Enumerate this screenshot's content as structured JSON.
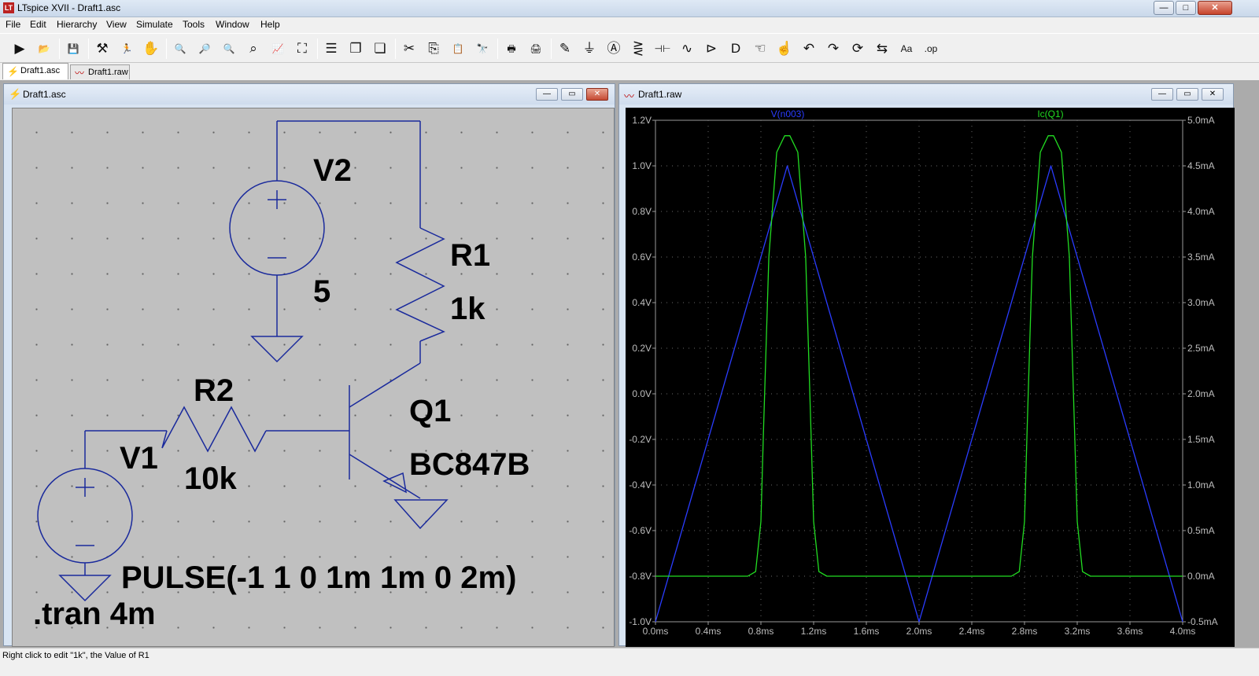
{
  "app": {
    "title": "LTspice XVII - Draft1.asc",
    "icon": "ltspice-icon",
    "window_controls": {
      "minimize": "—",
      "maximize": "□",
      "close": "✕"
    }
  },
  "menu": [
    "File",
    "Edit",
    "Hierarchy",
    "View",
    "Simulate",
    "Tools",
    "Window",
    "Help"
  ],
  "toolbar": [
    {
      "name": "open-schematic-icon",
      "glyph": "▶"
    },
    {
      "name": "open-folder-icon",
      "glyph": "📂"
    },
    {
      "name": "save-icon",
      "glyph": "💾"
    },
    {
      "name": "control-panel-icon",
      "glyph": "⚒"
    },
    {
      "name": "run-icon",
      "glyph": "🏃"
    },
    {
      "name": "halt-hand-icon",
      "glyph": "✋"
    },
    {
      "name": "zoom-in-icon",
      "glyph": "🔍"
    },
    {
      "name": "pan-icon",
      "glyph": "🔎"
    },
    {
      "name": "zoom-out-icon",
      "glyph": "🔍"
    },
    {
      "name": "zoom-cancel-icon",
      "glyph": "⌕"
    },
    {
      "name": "autorange-icon",
      "glyph": "📈"
    },
    {
      "name": "fit-icon",
      "glyph": "⛶"
    },
    {
      "name": "tile-horizontal-icon",
      "glyph": "☰"
    },
    {
      "name": "cascade-icon",
      "glyph": "❐"
    },
    {
      "name": "close-windows-icon",
      "glyph": "❏"
    },
    {
      "name": "cut-icon",
      "glyph": "✂"
    },
    {
      "name": "copy-icon",
      "glyph": "⎘"
    },
    {
      "name": "paste-icon",
      "glyph": "📋"
    },
    {
      "name": "find-icon",
      "glyph": "🔭"
    },
    {
      "name": "print-icon",
      "glyph": "🖶"
    },
    {
      "name": "print-preview-icon",
      "glyph": "🖨"
    },
    {
      "name": "draw-wire-icon",
      "glyph": "✎"
    },
    {
      "name": "ground-icon",
      "glyph": "⏚"
    },
    {
      "name": "label-net-icon",
      "glyph": "Ⓐ"
    },
    {
      "name": "resistor-icon",
      "glyph": "⋛"
    },
    {
      "name": "capacitor-icon",
      "glyph": "⊣⊢"
    },
    {
      "name": "inductor-icon",
      "glyph": "∿"
    },
    {
      "name": "diode-icon",
      "glyph": "⊳"
    },
    {
      "name": "component-icon",
      "glyph": "D"
    },
    {
      "name": "move-hand-icon",
      "glyph": "☜"
    },
    {
      "name": "drag-hand-icon",
      "glyph": "☝"
    },
    {
      "name": "undo-icon",
      "glyph": "↶"
    },
    {
      "name": "redo-icon",
      "glyph": "↷"
    },
    {
      "name": "rotate-icon",
      "glyph": "⟳"
    },
    {
      "name": "mirror-icon",
      "glyph": "⇆"
    },
    {
      "name": "text-icon",
      "glyph": "Aa"
    },
    {
      "name": "spice-directive-icon",
      "glyph": ".op"
    }
  ],
  "tabs": [
    {
      "label": "Draft1.asc",
      "icon": "schematic-tab-icon",
      "active": true
    },
    {
      "label": "Draft1.raw",
      "icon": "waveform-tab-icon",
      "active": false
    }
  ],
  "schematic": {
    "title": "Draft1.asc",
    "labels": {
      "v2_name": "V2",
      "v2_value": "5",
      "r1_name": "R1",
      "r1_value": "1k",
      "r2_name": "R2",
      "r2_value": "10k",
      "v1_name": "V1",
      "q1_name": "Q1",
      "q1_model": "BC847B",
      "v1_value": "PULSE(-1 1 0 1m 1m 0 2m)",
      "directive": ".tran 4m"
    },
    "plus": "+",
    "minus": "—"
  },
  "waveform": {
    "title": "Draft1.raw",
    "trace_labels": [
      "V(n003)",
      "Ic(Q1)"
    ],
    "colors": {
      "v_trace": "#2a3cff",
      "i_trace": "#22dd22",
      "v_label": "#2a3cff",
      "i_label": "#22dd22"
    },
    "x_ticks": [
      "0.0ms",
      "0.4ms",
      "0.8ms",
      "1.2ms",
      "1.6ms",
      "2.0ms",
      "2.4ms",
      "2.8ms",
      "3.2ms",
      "3.6ms",
      "4.0ms"
    ],
    "left_ticks": [
      "1.2V",
      "1.0V",
      "0.8V",
      "0.6V",
      "0.4V",
      "0.2V",
      "0.0V",
      "-0.2V",
      "-0.4V",
      "-0.6V",
      "-0.8V",
      "-1.0V"
    ],
    "right_ticks": [
      "5.0mA",
      "4.5mA",
      "4.0mA",
      "3.5mA",
      "3.0mA",
      "2.5mA",
      "2.0mA",
      "1.5mA",
      "1.0mA",
      "0.5mA",
      "0.0mA",
      "-0.5mA"
    ]
  },
  "chart_data": {
    "type": "line",
    "xlabel": "",
    "ylabel": "",
    "xlim": [
      0,
      4
    ],
    "ylim": [
      -1.0,
      1.2
    ],
    "y2lim": [
      -0.5,
      5.0
    ],
    "grid": true,
    "series": [
      {
        "name": "V(n003)",
        "axis": "left",
        "x": [
          0,
          1.0,
          2.0,
          3.0,
          4.0
        ],
        "y": [
          -1.0,
          1.0,
          -1.0,
          1.0,
          -1.0
        ]
      },
      {
        "name": "Ic(Q1)",
        "axis": "right",
        "x": [
          0,
          0.7,
          0.76,
          0.8,
          0.82,
          0.86,
          0.92,
          0.98,
          1.02,
          1.08,
          1.14,
          1.18,
          1.2,
          1.24,
          1.3,
          2.7,
          2.76,
          2.8,
          2.82,
          2.86,
          2.92,
          2.98,
          3.02,
          3.08,
          3.14,
          3.18,
          3.2,
          3.24,
          3.3,
          4.0
        ],
        "y": [
          0.0,
          0.0,
          0.05,
          0.6,
          1.6,
          3.5,
          4.65,
          4.83,
          4.83,
          4.65,
          3.5,
          1.6,
          0.6,
          0.05,
          0.0,
          0.0,
          0.05,
          0.6,
          1.6,
          3.5,
          4.65,
          4.83,
          4.83,
          4.65,
          3.5,
          1.6,
          0.6,
          0.05,
          0.0,
          0.0
        ]
      }
    ]
  },
  "status": {
    "text": "Right click to edit \"1k\", the Value of R1"
  }
}
